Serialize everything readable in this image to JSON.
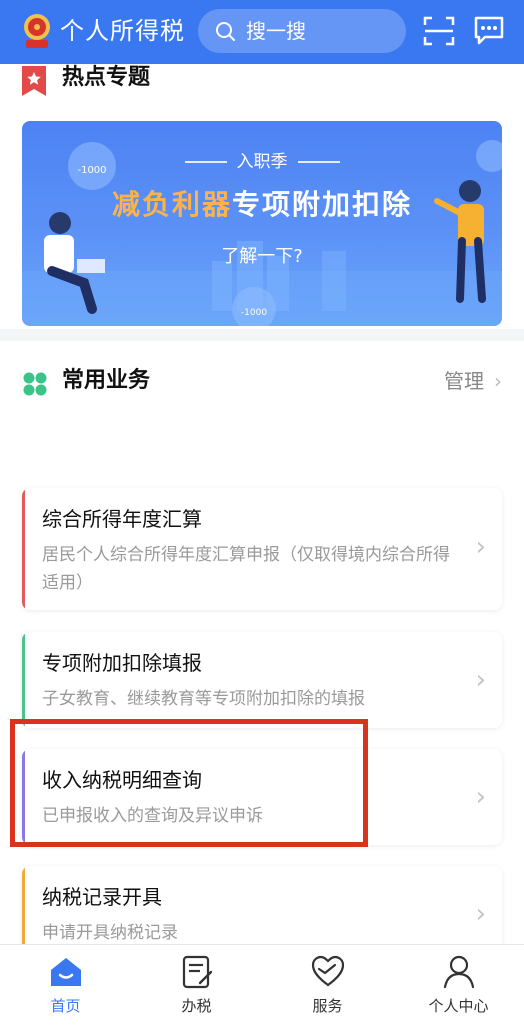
{
  "header": {
    "app_title": "个人所得税",
    "search_placeholder": "搜一搜",
    "brand_color": "#3a78f2",
    "icons": [
      "emblem-icon",
      "search-icon",
      "scan-icon",
      "message-icon"
    ]
  },
  "hot_topics": {
    "title": "热点专题",
    "banner": {
      "eyebrow": "入职季",
      "title_highlight": "减负利器",
      "title_rest": "专项附加扣除",
      "cta": "了解一下?",
      "decor_value_1": "-1000",
      "decor_value_2": "-1000"
    }
  },
  "common_services": {
    "title": "常用业务",
    "manage_label": "管理",
    "items": [
      {
        "title": "综合所得年度汇算",
        "desc": "居民个人综合所得年度汇算申报（仅取得境内综合所得适用）",
        "accent": "#e25a5a"
      },
      {
        "title": "专项附加扣除填报",
        "desc": "子女教育、继续教育等专项附加扣除的填报",
        "accent": "#4cc38a"
      },
      {
        "title": "收入纳税明细查询",
        "desc": "已申报收入的查询及异议申诉",
        "accent": "#8a78e6"
      },
      {
        "title": "纳税记录开具",
        "desc": "申请开具纳税记录",
        "accent": "#f2a93b"
      }
    ]
  },
  "tabbar": {
    "items": [
      {
        "label": "首页",
        "icon": "home-icon",
        "active": true
      },
      {
        "label": "办税",
        "icon": "tax-form-icon",
        "active": false
      },
      {
        "label": "服务",
        "icon": "service-heart-icon",
        "active": false
      },
      {
        "label": "个人中心",
        "icon": "user-icon",
        "active": false
      }
    ]
  }
}
